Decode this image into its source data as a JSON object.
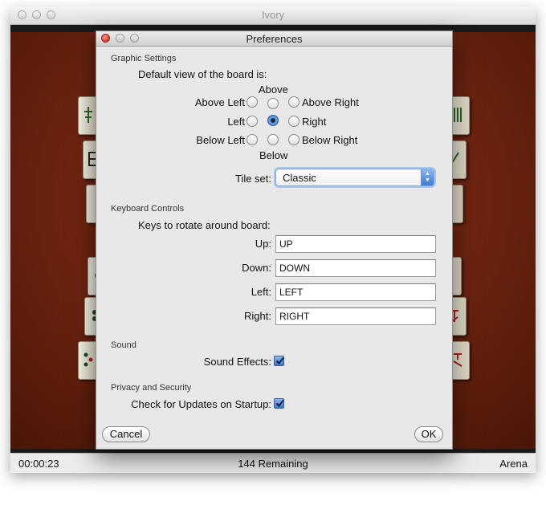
{
  "window": {
    "title": "Ivory"
  },
  "status_bar": {
    "time": "00:00:23",
    "remaining": "144 Remaining",
    "layout": "Arena"
  },
  "dialog": {
    "title": "Preferences",
    "graphic_settings": {
      "heading": "Graphic Settings",
      "prompt": "Default view of the board is:",
      "views": {
        "above": "Above",
        "above_left": "Above Left",
        "above_right": "Above Right",
        "left": "Left",
        "right": "Right",
        "below_left": "Below Left",
        "below_right": "Below Right",
        "below": "Below"
      },
      "selected_view": "center",
      "tile_set_label": "Tile set:",
      "tile_set_value": "Classic"
    },
    "keyboard_controls": {
      "heading": "Keyboard Controls",
      "prompt": "Keys to rotate around board:",
      "keys": [
        {
          "label": "Up:",
          "value": "UP"
        },
        {
          "label": "Down:",
          "value": "DOWN"
        },
        {
          "label": "Left:",
          "value": "LEFT"
        },
        {
          "label": "Right:",
          "value": "RIGHT"
        }
      ]
    },
    "sound": {
      "heading": "Sound",
      "effects_label": "Sound Effects:",
      "effects_checked": true
    },
    "privacy": {
      "heading": "Privacy and Security",
      "updates_label": "Check for Updates on Startup:",
      "updates_checked": true
    },
    "buttons": {
      "cancel": "Cancel",
      "ok": "OK"
    }
  },
  "colors": {
    "board": "#6e2410",
    "accent": "#3a7bd5"
  }
}
